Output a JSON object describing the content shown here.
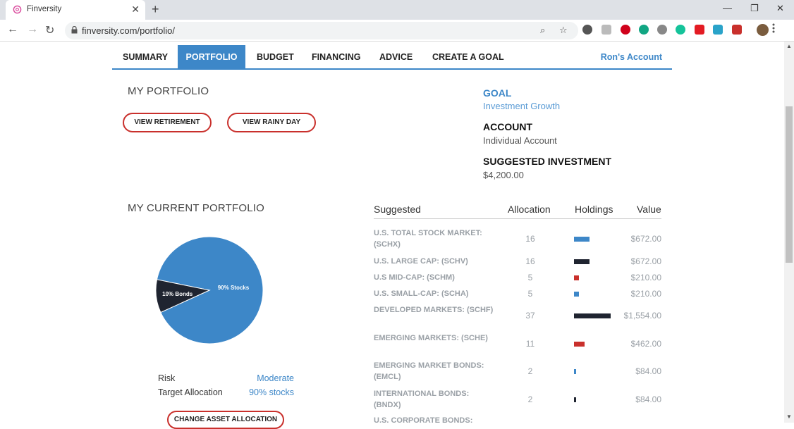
{
  "browser": {
    "tab_title": "Finversity",
    "url": "finversity.com/portfolio/",
    "colors": {
      "favicon": "#d9459a"
    }
  },
  "nav": {
    "items": [
      "SUMMARY",
      "PORTFOLIO",
      "BUDGET",
      "FINANCING",
      "ADVICE",
      "CREATE A GOAL"
    ],
    "active": "PORTFOLIO",
    "account": "Ron's Account"
  },
  "my_portfolio": {
    "title": "MY PORTFOLIO",
    "view_retirement": "VIEW RETIREMENT",
    "view_rainy_day": "VIEW RAINY DAY"
  },
  "goal_panel": {
    "goal_label": "GOAL",
    "goal_value": "Investment Growth",
    "account_label": "ACCOUNT",
    "account_value": "Individual Account",
    "suggested_label": "SUGGESTED INVESTMENT",
    "suggested_value": "$4,200.00"
  },
  "current_portfolio": {
    "title": "MY CURRENT PORTFOLIO",
    "risk_label": "Risk",
    "risk_value": "Moderate",
    "target_label": "Target Allocation",
    "target_value": "90% stocks",
    "change_button": "CHANGE ASSET ALLOCATION"
  },
  "chart_data": {
    "type": "pie",
    "slices": [
      {
        "label": "90% Stocks",
        "value": 90,
        "color": "#3d87c8"
      },
      {
        "label": "10% Bonds",
        "value": 10,
        "color": "#1f2430"
      }
    ]
  },
  "holdings_table": {
    "headers": [
      "Suggested",
      "Allocation",
      "Holdings",
      "Value"
    ],
    "rows": [
      {
        "name": "U.S. TOTAL STOCK MARKET: (SCHX)",
        "allocation": "16",
        "value": "$672.00",
        "bar_pct": 16,
        "bar_color": "#3d87c8"
      },
      {
        "name": "U.S. LARGE CAP: (SCHV)",
        "allocation": "16",
        "value": "$672.00",
        "bar_pct": 16,
        "bar_color": "#1f2430"
      },
      {
        "name": "U.S MID-CAP: (SCHM)",
        "allocation": "5",
        "value": "$210.00",
        "bar_pct": 5,
        "bar_color": "#c9302c"
      },
      {
        "name": "U.S. SMALL-CAP: (SCHA)",
        "allocation": "5",
        "value": "$210.00",
        "bar_pct": 5,
        "bar_color": "#3d87c8"
      },
      {
        "name": "DEVELOPED MARKETS: (SCHF)",
        "allocation": "37",
        "value": "$1,554.00",
        "bar_pct": 37,
        "bar_color": "#1f2430"
      },
      {
        "name": "EMERGING MARKETS: (SCHE)",
        "allocation": "11",
        "value": "$462.00",
        "bar_pct": 11,
        "bar_color": "#c9302c"
      },
      {
        "name": "EMERGING MARKET BONDS: (EMCL)",
        "allocation": "2",
        "value": "$84.00",
        "bar_pct": 2,
        "bar_color": "#3d87c8"
      },
      {
        "name": "INTERNATIONAL BONDS: (BNDX)",
        "allocation": "2",
        "value": "$84.00",
        "bar_pct": 2,
        "bar_color": "#1f2430"
      },
      {
        "name": "U.S. CORPORATE BONDS:",
        "allocation": "",
        "value": "",
        "bar_pct": 0,
        "bar_color": "#c9302c"
      }
    ]
  }
}
